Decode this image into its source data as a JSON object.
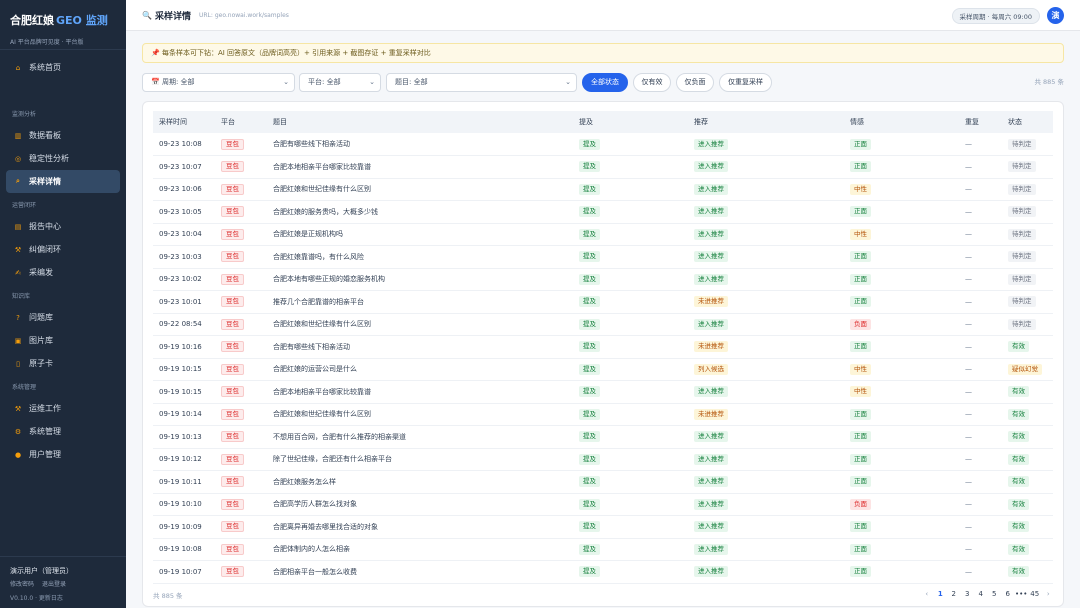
{
  "brand": {
    "title": "合肥红娘",
    "geo": "GEO 监测",
    "subtitle": "AI 平台品牌可见度 · 平台版"
  },
  "sidebar": {
    "home": {
      "icon": "home-icon",
      "glyph": "⌂",
      "label": "系统首页"
    },
    "sections": [
      {
        "title": "监测分析",
        "items": [
          {
            "icon": "bar-chart-icon",
            "glyph": "▥",
            "label": "数据看板",
            "active": false
          },
          {
            "icon": "target-icon",
            "glyph": "◎",
            "label": "稳定性分析",
            "active": false
          },
          {
            "icon": "search-icon",
            "glyph": "⌕",
            "label": "采样详情",
            "active": true
          }
        ]
      },
      {
        "title": "运营闭环",
        "items": [
          {
            "icon": "clipboard-icon",
            "glyph": "▤",
            "label": "报告中心",
            "active": false
          },
          {
            "icon": "wrench-icon",
            "glyph": "⚒",
            "label": "纠偏闭环",
            "active": false
          },
          {
            "icon": "writing-hand-icon",
            "glyph": "✍",
            "label": "采编发",
            "active": false
          }
        ]
      },
      {
        "title": "知识库",
        "items": [
          {
            "icon": "question-icon",
            "glyph": "?",
            "label": "问题库",
            "active": false
          },
          {
            "icon": "image-icon",
            "glyph": "▣",
            "label": "图片库",
            "active": false
          },
          {
            "icon": "card-icon",
            "glyph": "▯",
            "label": "原子卡",
            "active": false
          }
        ]
      },
      {
        "title": "系统管理",
        "items": [
          {
            "icon": "tools-icon",
            "glyph": "⚒",
            "label": "运维工作",
            "active": false
          },
          {
            "icon": "gear-icon",
            "glyph": "⚙",
            "label": "系统管理",
            "active": false
          },
          {
            "icon": "user-icon",
            "glyph": "●",
            "label": "用户管理",
            "active": false
          }
        ]
      }
    ],
    "footer": {
      "user": "演示用户（管理员）",
      "change_password": "修改密码",
      "logout": "退出登录",
      "version": "V0.10.0 · 更新日志"
    }
  },
  "header": {
    "title_icon": "search-icon",
    "title": "采样详情",
    "url": "URL: geo.nowai.work/samples",
    "cycle": "采样周期 · 每周六 09:00",
    "avatar": "演"
  },
  "tip": {
    "icon": "pin-icon",
    "text": "📌 每条样本可下钻：AI 回答原文（品牌词高亮）+ 引用来源 + 截图存证 + 重复采样对比"
  },
  "filters": {
    "period": "📅 周期:  全部",
    "platform": "平台:  全部",
    "question": "题目:  全部",
    "buttons": [
      "全部状态",
      "仅有效",
      "仅负面",
      "仅重复采样"
    ],
    "active": 0,
    "total": "共 885 条"
  },
  "table": {
    "headers": [
      "采样时间",
      "平台",
      "题目",
      "提及",
      "推荐",
      "情感",
      "重复",
      "状态"
    ],
    "rows": [
      [
        "09-23 10:08",
        "豆包",
        "合肥有哪些线下相亲活动",
        "提及",
        "进入推荐",
        "正面",
        "—",
        "待判定"
      ],
      [
        "09-23 10:07",
        "豆包",
        "合肥本地相亲平台哪家比较靠谱",
        "提及",
        "进入推荐",
        "正面",
        "—",
        "待判定"
      ],
      [
        "09-23 10:06",
        "豆包",
        "合肥红娘和世纪佳缘有什么区别",
        "提及",
        "进入推荐",
        "中性",
        "—",
        "待判定"
      ],
      [
        "09-23 10:05",
        "豆包",
        "合肥红娘的服务贵吗，大概多少钱",
        "提及",
        "进入推荐",
        "正面",
        "—",
        "待判定"
      ],
      [
        "09-23 10:04",
        "豆包",
        "合肥红娘是正规机构吗",
        "提及",
        "进入推荐",
        "中性",
        "—",
        "待判定"
      ],
      [
        "09-23 10:03",
        "豆包",
        "合肥红娘靠谱吗，有什么风险",
        "提及",
        "进入推荐",
        "正面",
        "—",
        "待判定"
      ],
      [
        "09-23 10:02",
        "豆包",
        "合肥本地有哪些正规的婚恋服务机构",
        "提及",
        "进入推荐",
        "正面",
        "—",
        "待判定"
      ],
      [
        "09-23 10:01",
        "豆包",
        "推荐几个合肥靠谱的相亲平台",
        "提及",
        "未进推荐",
        "正面",
        "—",
        "待判定"
      ],
      [
        "09-22 08:54",
        "豆包",
        "合肥红娘和世纪佳缘有什么区别",
        "提及",
        "进入推荐",
        "负面",
        "—",
        "待判定"
      ],
      [
        "09-19 10:16",
        "豆包",
        "合肥有哪些线下相亲活动",
        "提及",
        "未进推荐",
        "正面",
        "—",
        "有效"
      ],
      [
        "09-19 10:15",
        "豆包",
        "合肥红娘的运营公司是什么",
        "提及",
        "列入候选",
        "中性",
        "—",
        "疑似幻觉"
      ],
      [
        "09-19 10:15",
        "豆包",
        "合肥本地相亲平台哪家比较靠谱",
        "提及",
        "进入推荐",
        "中性",
        "—",
        "有效"
      ],
      [
        "09-19 10:14",
        "豆包",
        "合肥红娘和世纪佳缘有什么区别",
        "提及",
        "未进推荐",
        "正面",
        "—",
        "有效"
      ],
      [
        "09-19 10:13",
        "豆包",
        "不想用百合网，合肥有什么推荐的相亲渠道",
        "提及",
        "进入推荐",
        "正面",
        "—",
        "有效"
      ],
      [
        "09-19 10:12",
        "豆包",
        "除了世纪佳缘，合肥还有什么相亲平台",
        "提及",
        "进入推荐",
        "正面",
        "—",
        "有效"
      ],
      [
        "09-19 10:11",
        "豆包",
        "合肥红娘服务怎么样",
        "提及",
        "进入推荐",
        "正面",
        "—",
        "有效"
      ],
      [
        "09-19 10:10",
        "豆包",
        "合肥高学历人群怎么找对象",
        "提及",
        "进入推荐",
        "负面",
        "—",
        "有效"
      ],
      [
        "09-19 10:09",
        "豆包",
        "合肥离异再婚去哪里找合适的对象",
        "提及",
        "进入推荐",
        "正面",
        "—",
        "有效"
      ],
      [
        "09-19 10:08",
        "豆包",
        "合肥体制内的人怎么相亲",
        "提及",
        "进入推荐",
        "正面",
        "—",
        "有效"
      ],
      [
        "09-19 10:07",
        "豆包",
        "合肥相亲平台一般怎么收费",
        "提及",
        "进入推荐",
        "正面",
        "—",
        "有效"
      ]
    ]
  },
  "pagination": {
    "total": "共 885 条",
    "prev": "‹",
    "pages": [
      "1",
      "2",
      "3",
      "4",
      "5",
      "6",
      "•••",
      "45"
    ],
    "current": "1",
    "next": "›"
  },
  "colors": {
    "accent": "#2563eb",
    "sidebar_bg": "#1e2a3b",
    "positive": "#15803d",
    "warning": "#b45309",
    "negative": "#dc2626"
  }
}
